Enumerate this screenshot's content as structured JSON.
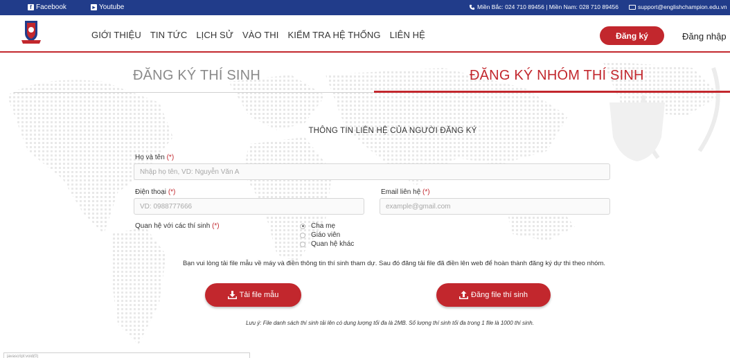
{
  "topbar": {
    "facebook": "Facebook",
    "youtube": "Youtube",
    "hotline": "Miền Bắc: 024 710 89456 | Miền Nam: 028 710 89456",
    "email": "support@englishchampion.edu.vn"
  },
  "nav": {
    "menu": [
      "GIỚI THIỆU",
      "TIN TỨC",
      "LỊCH SỬ",
      "VÀO THI",
      "KIỂM TRA HỆ THỐNG",
      "LIÊN HỆ"
    ],
    "register": "Đăng ký",
    "login": "Đăng nhập"
  },
  "tabs": {
    "individual": "ĐĂNG KÝ THÍ SINH",
    "group": "ĐĂNG KÝ NHÓM THÍ SINH"
  },
  "form": {
    "title": "THÔNG TIN LIÊN HỆ CỦA NGƯỜI ĐĂNG KÝ",
    "name_label": "Họ và tên",
    "name_placeholder": "Nhập họ tên, VD: Nguyễn Văn A",
    "phone_label": "Điện thoại",
    "phone_placeholder": "VD: 0988777666",
    "email_label": "Email liên hệ",
    "email_placeholder": "example@gmail.com",
    "required_mark": "(*)",
    "relation_label": "Quan hệ với các thí sinh",
    "relation_options": [
      "Cha mẹ",
      "Giáo viên",
      "Quan hệ khác"
    ],
    "relation_selected": "Cha mẹ",
    "instruction": "Bạn vui lòng tải file mẫu về máy và điền thông tin thí sinh tham dự. Sau đó đăng tải file đã điền lên web để hoàn thành đăng ký dự thi theo nhóm.",
    "download_button": "Tải file mẫu",
    "upload_button": "Đăng file thí sinh",
    "note": "Lưu ý: File danh sách thí sinh tải lên có dung lượng tối đa là 2MB. Số lượng thí sinh tối đa trong 1 file là 1000 thí sinh."
  },
  "status_bar": "javascript:void(0)",
  "colors": {
    "brand_red": "#c2272d",
    "topbar_blue": "#213c8a"
  }
}
